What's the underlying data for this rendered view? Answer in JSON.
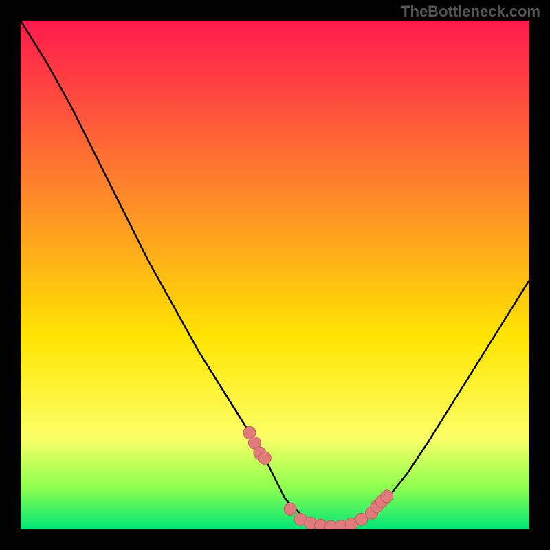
{
  "watermark": "TheBottleneck.com",
  "colors": {
    "frame": "#000000",
    "curve": "#000000",
    "marker_fill": "#e07b7b",
    "marker_stroke": "#c25f5f",
    "gradient_top": "#ff1a4d",
    "gradient_mid1": "#ff8a2a",
    "gradient_mid2": "#ffe400",
    "gradient_mid3": "#fbff66",
    "gradient_bottom1": "#8aff4f",
    "gradient_bottom2": "#00e676"
  },
  "chart_data": {
    "type": "line",
    "title": "",
    "xlabel": "",
    "ylabel": "",
    "xlim": [
      0,
      100
    ],
    "ylim": [
      0,
      100
    ],
    "curve": {
      "x": [
        0,
        5,
        10,
        15,
        20,
        25,
        30,
        35,
        40,
        45,
        48,
        50,
        52,
        55,
        58,
        60,
        62,
        65,
        68,
        72,
        76,
        80,
        85,
        90,
        95,
        100
      ],
      "y": [
        100,
        92,
        83,
        73,
        63,
        53,
        44,
        35,
        27,
        19,
        14,
        10,
        6,
        3,
        1,
        0.5,
        0.5,
        1,
        3,
        6,
        11,
        17,
        25,
        33,
        41,
        49
      ]
    },
    "markers": {
      "x": [
        45,
        46,
        47,
        48,
        53,
        55,
        57,
        59,
        61,
        63,
        65,
        67,
        69,
        70,
        71,
        72
      ],
      "y": [
        19,
        17,
        15,
        14,
        4,
        2,
        1.2,
        0.8,
        0.5,
        0.6,
        1,
        2,
        3.2,
        4.5,
        5.5,
        6.5
      ]
    },
    "annotations": [],
    "legend": []
  }
}
